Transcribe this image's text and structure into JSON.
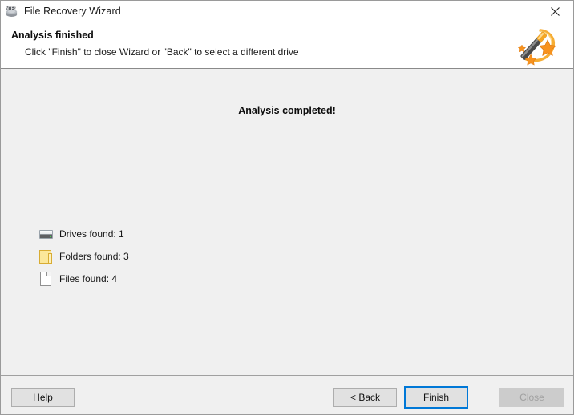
{
  "window": {
    "title": "File Recovery Wizard",
    "icon": "ntfs-drive-icon",
    "close_icon": "close-icon"
  },
  "header": {
    "title": "Analysis finished",
    "subtitle": "Click \"Finish\" to close Wizard or \"Back\" to select a different drive",
    "art_icon": "magic-wand-icon"
  },
  "content": {
    "completed_message": "Analysis completed!",
    "stats": [
      {
        "icon": "drive-icon",
        "label": "Drives found: 1"
      },
      {
        "icon": "folder-icon",
        "label": "Folders found: 3"
      },
      {
        "icon": "file-icon",
        "label": "Files found: 4"
      }
    ]
  },
  "footer": {
    "help_label": "Help",
    "back_label": "< Back",
    "finish_label": "Finish",
    "close_label": "Close"
  },
  "colors": {
    "accent": "#0078d7",
    "content_bg": "#f0f0f0",
    "button_bg": "#e1e1e1",
    "folder_yellow": "#fbe79a",
    "led_green": "#3ddc4a"
  }
}
